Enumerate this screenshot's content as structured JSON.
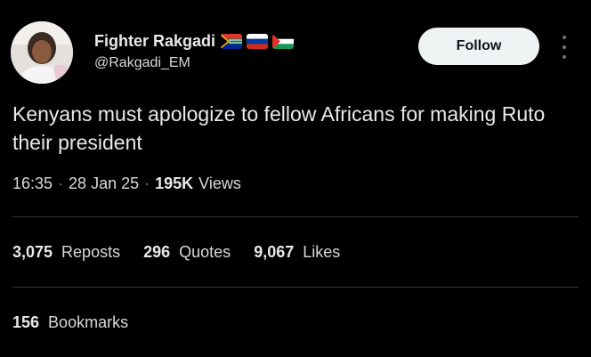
{
  "author": {
    "display_name": "Fighter Rakgadi",
    "handle": "@Rakgadi_EM",
    "flags": [
      "south-africa-flag-icon",
      "russia-flag-icon",
      "palestine-flag-icon"
    ]
  },
  "follow_button": {
    "label": "Follow"
  },
  "more_button": {
    "icon": "more-vertical-icon"
  },
  "tweet": {
    "text": "Kenyans must apologize to fellow Africans for making Ruto their president",
    "time": "16:35",
    "date": "28 Jan 25",
    "views_count": "195K",
    "views_label": "Views",
    "separator": "·"
  },
  "stats": {
    "reposts": {
      "count": "3,075",
      "label": "Reposts"
    },
    "quotes": {
      "count": "296",
      "label": "Quotes"
    },
    "likes": {
      "count": "9,067",
      "label": "Likes"
    },
    "bookmarks": {
      "count": "156",
      "label": "Bookmarks"
    }
  },
  "colors": {
    "background": "#000000",
    "text": "#e7e9ea",
    "secondary": "#71767b",
    "divider": "#2f3336",
    "follow_bg": "#eff3f4"
  }
}
